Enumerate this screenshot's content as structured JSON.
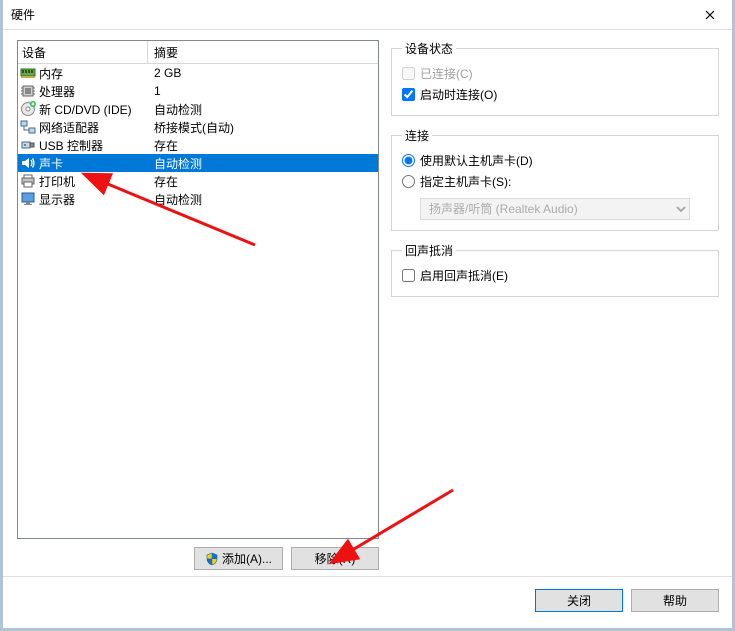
{
  "window": {
    "title": "硬件"
  },
  "list": {
    "header_device": "设备",
    "header_summary": "摘要",
    "rows": [
      {
        "name": "内存",
        "summary": "2 GB",
        "icon": "memory"
      },
      {
        "name": "处理器",
        "summary": "1",
        "icon": "cpu"
      },
      {
        "name": "新 CD/DVD (IDE)",
        "summary": "自动检测",
        "icon": "cd"
      },
      {
        "name": "网络适配器",
        "summary": "桥接模式(自动)",
        "icon": "network"
      },
      {
        "name": "USB 控制器",
        "summary": "存在",
        "icon": "usb"
      },
      {
        "name": "声卡",
        "summary": "自动检测",
        "icon": "sound",
        "selected": true
      },
      {
        "name": "打印机",
        "summary": "存在",
        "icon": "printer"
      },
      {
        "name": "显示器",
        "summary": "自动检测",
        "icon": "display"
      }
    ]
  },
  "buttons": {
    "add": "添加(A)...",
    "remove": "移除(R)",
    "close": "关闭",
    "help": "帮助"
  },
  "panel_status": {
    "legend": "设备状态",
    "connected_label": "已连接(C)",
    "connected_checked": false,
    "connected_enabled": false,
    "autoconnect_label": "启动时连接(O)",
    "autoconnect_checked": true
  },
  "panel_connection": {
    "legend": "连接",
    "default_label": "使用默认主机声卡(D)",
    "specify_label": "指定主机声卡(S):",
    "selected_radio": "default",
    "select_value": "扬声器/听筒 (Realtek Audio)"
  },
  "panel_echo": {
    "legend": "回声抵消",
    "enable_label": "启用回声抵消(E)",
    "enable_checked": false
  }
}
